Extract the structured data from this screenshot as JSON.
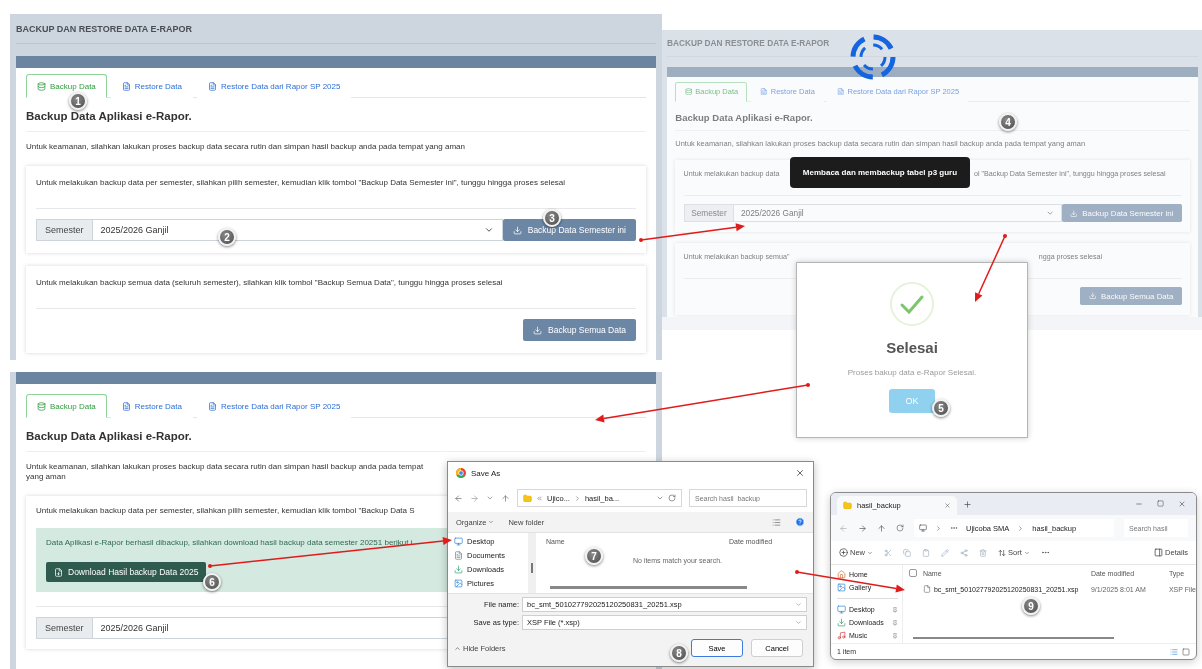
{
  "main_page": {
    "title": "BACKUP DAN RESTORE DATA E-RAPOR",
    "tabs": [
      {
        "label": "Backup Data",
        "kind": "database",
        "selected": true
      },
      {
        "label": "Restore Data",
        "kind": "file",
        "selected": false
      },
      {
        "label": "Restore Data dari Rapor SP 2025",
        "kind": "file",
        "selected": false
      }
    ],
    "heading": "Backup Data Aplikasi e-Rapor.",
    "intro": "Untuk keamanan, silahkan lakukan proses backup data secara rutin dan simpan hasil backup anda pada tempat yang aman",
    "semester_box": {
      "text": "Untuk melakukan backup data per semester, silahkan pilih semester, kemudian klik tombol \"Backup Data Semester ini\", tunggu hingga proses selesai",
      "select_label": "Semester",
      "select_value": "2025/2026 Ganjil",
      "button": "Backup Data Semester ini"
    },
    "all_box": {
      "text": "Untuk melakukan backup semua data (seluruh semester), silahkan klik tombol \"Backup Semua Data\", tunggu hingga proses selesai",
      "button": "Backup Semua Data"
    }
  },
  "loading_view": {
    "title": "BACKUP DAN RESTORE DATA E-RAPOR",
    "tabs": [
      {
        "label": "Backup Data",
        "kind": "database",
        "selected": true
      },
      {
        "label": "Restore Data",
        "kind": "file",
        "selected": false
      },
      {
        "label": "Restore Data dari Rapor SP 2025",
        "kind": "file",
        "selected": false
      }
    ],
    "heading": "Backup Data Aplikasi e-Rapor.",
    "intro": "Untuk keamanan, silahkan lakukan proses backup data secara rutin dan simpan hasil backup anda pada tempat yang aman",
    "semester_box": {
      "text_parts": [
        "Untuk melakukan backup data",
        "ol \"Backup Data Semester ini\", tunggu hingga proses selesai"
      ],
      "select_label": "Semester",
      "select_value": "2025/2026 Ganjil",
      "button": "Backup Data Semester ini"
    },
    "all_box": {
      "text_parts": [
        "Untuk melakukan backup semua\"",
        "ngga proses selesai"
      ],
      "button": "Backup Semua Data"
    },
    "tooltip": "Membaca dan membackup tabel p3 guru"
  },
  "success_dialog": {
    "title": "Selesai",
    "message": "Proses bakup data e-Rapor Selesai.",
    "button": "OK"
  },
  "result_page": {
    "tabs": [
      {
        "label": "Backup Data",
        "kind": "database",
        "selected": true
      },
      {
        "label": "Restore Data",
        "kind": "file",
        "selected": false
      },
      {
        "label": "Restore Data dari Rapor SP 2025",
        "kind": "file",
        "selected": false
      }
    ],
    "heading": "Backup Data Aplikasi e-Rapor.",
    "intro": "Untuk keamanan, silahkan lakukan proses backup data secara rutin dan simpan hasil backup anda pada tempat yang aman",
    "semester_text": "Untuk melakukan backup data per semester, silahkan pilih semester, kemudian klik tombol \"Backup Data S",
    "alert": {
      "text": "Data Aplikasi e-Rapor berhasil dibackup, silahkan download hasil backup data semester 20251 berikut i",
      "button": "Download Hasil backup Data 2025"
    },
    "select_label": "Semester",
    "select_value": "2025/2026 Ganjil"
  },
  "save_dialog": {
    "title": "Save As",
    "path": [
      "Ujico...",
      "hasil_ba..."
    ],
    "search_placeholder": "Search hasil_backup",
    "organize": "Organize",
    "new_folder": "New folder",
    "folders": [
      {
        "label": "Desktop",
        "kind": "desktop"
      },
      {
        "label": "Documents",
        "kind": "documents"
      },
      {
        "label": "Downloads",
        "kind": "downloads"
      },
      {
        "label": "Pictures",
        "kind": "pictures"
      }
    ],
    "columns": [
      "Name",
      "Date modified"
    ],
    "empty_message": "No items match your search.",
    "file_name_label": "File name:",
    "file_name": "bc_smt_501027792025120250831_20251.xsp",
    "type_label": "Save as type:",
    "type_value": "XSP File (*.xsp)",
    "hide_folders": "Hide Folders",
    "buttons": [
      "Save",
      "Cancel"
    ]
  },
  "explorer": {
    "tab": "hasil_backup",
    "path": [
      "Ujicoba SMA",
      "hasil_backup"
    ],
    "search_placeholder": "Search hasil",
    "toolbar": {
      "new": "New",
      "sort": "Sort",
      "details": "Details"
    },
    "nav": [
      {
        "label": "Home",
        "kind": "home",
        "pinned": false
      },
      {
        "label": "Gallery",
        "kind": "gallery",
        "pinned": false
      },
      {
        "label": "Desktop",
        "kind": "desktop",
        "pinned": true
      },
      {
        "label": "Downloads",
        "kind": "downloads",
        "pinned": true
      },
      {
        "label": "Music",
        "kind": "music",
        "pinned": true
      }
    ],
    "columns": [
      "Name",
      "Date modified",
      "Type"
    ],
    "select_all": {
      "checked": false
    },
    "files": [
      {
        "name": "bc_smt_501027792025120250831_20251.xsp",
        "date": "9/1/2025 8:01 AM",
        "type": "XSP File"
      }
    ],
    "status": "1 item"
  },
  "markers": [
    "1",
    "2",
    "3",
    "4",
    "5",
    "6",
    "7",
    "8",
    "9"
  ]
}
